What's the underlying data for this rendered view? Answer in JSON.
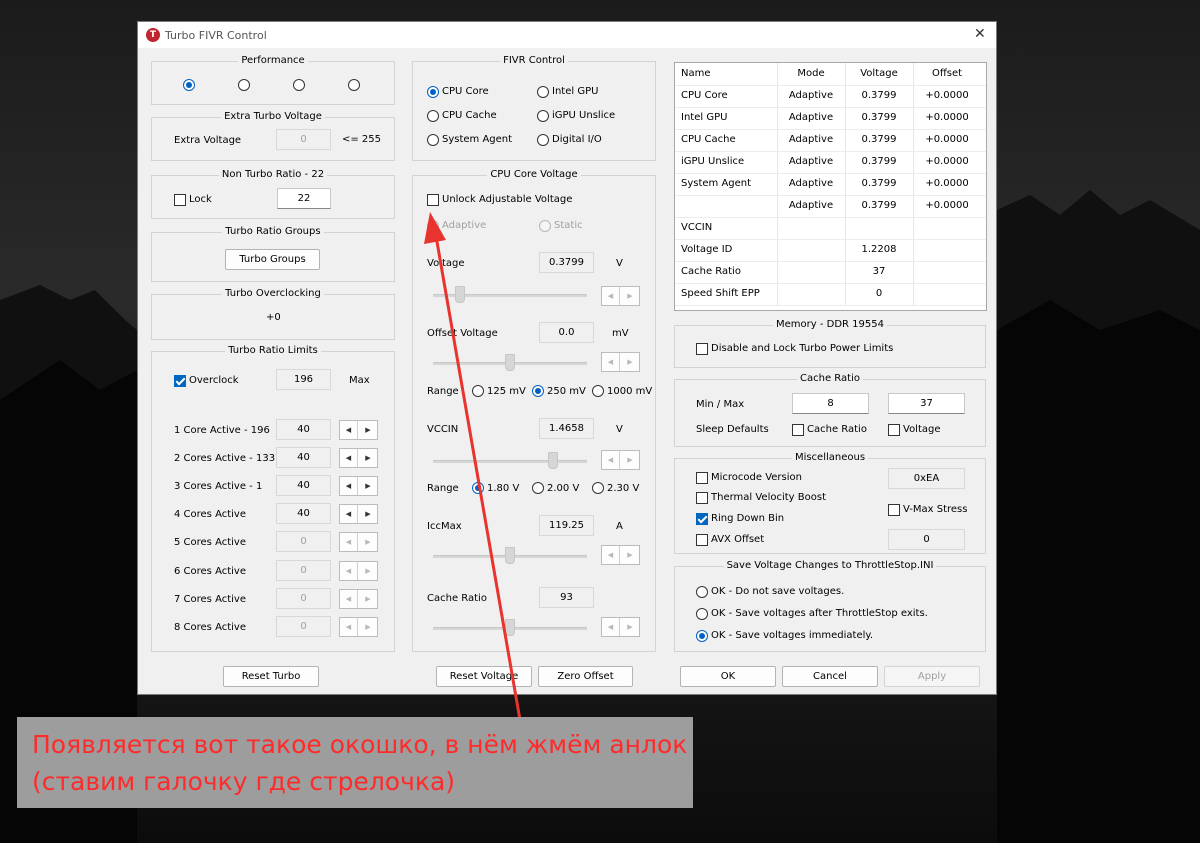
{
  "window": {
    "title": "Turbo FIVR Control",
    "close_glyph": "✕",
    "logo_letter": "T"
  },
  "performance": {
    "title": "Performance",
    "selected_index": 0,
    "option_count": 4
  },
  "extra_turbo": {
    "title": "Extra Turbo Voltage",
    "label": "Extra Voltage",
    "value": "0",
    "hint": "<= 255"
  },
  "non_turbo": {
    "title": "Non Turbo Ratio - 22",
    "lock_label": "Lock",
    "lock_checked": false,
    "value": "22"
  },
  "turbo_groups": {
    "title": "Turbo Ratio Groups",
    "button": "Turbo Groups"
  },
  "turbo_oc": {
    "title": "Turbo Overclocking",
    "value": "+0"
  },
  "turbo_limits": {
    "title": "Turbo Ratio Limits",
    "overclock_label": "Overclock",
    "overclock_checked": true,
    "max_value": "196",
    "max_label": "Max",
    "rows": [
      {
        "label": "1 Core  Active - 196",
        "value": "40",
        "enabled": true
      },
      {
        "label": "2 Cores Active - 133",
        "value": "40",
        "enabled": true
      },
      {
        "label": "3 Cores Active - 1",
        "value": "40",
        "enabled": true
      },
      {
        "label": "4 Cores Active",
        "value": "40",
        "enabled": true
      },
      {
        "label": "5 Cores Active",
        "value": "0",
        "enabled": false
      },
      {
        "label": "6 Cores Active",
        "value": "0",
        "enabled": false
      },
      {
        "label": "7 Cores Active",
        "value": "0",
        "enabled": false
      },
      {
        "label": "8 Cores Active",
        "value": "0",
        "enabled": false
      }
    ]
  },
  "fivr": {
    "title": "FIVR Control",
    "options": [
      "CPU Core",
      "Intel GPU",
      "CPU Cache",
      "iGPU Unslice",
      "System Agent",
      "Digital I/O"
    ],
    "selected": "CPU Core"
  },
  "core_voltage": {
    "title": "CPU Core Voltage",
    "unlock_label": "Unlock Adjustable Voltage",
    "unlock_checked": false,
    "adaptive_label": "Adaptive",
    "static_label": "Static",
    "voltage_label": "Voltage",
    "voltage_value": "0.3799",
    "voltage_unit": "V",
    "voltage_slider": 0.15,
    "offset_label": "Offset Voltage",
    "offset_value": "0.0",
    "offset_unit": "mV",
    "offset_slider": 0.5,
    "range_label": "Range",
    "range_options": [
      "125 mV",
      "250 mV",
      "1000 mV"
    ],
    "range_selected": "250 mV",
    "vccin_label": "VCCIN",
    "vccin_value": "1.4658",
    "vccin_unit": "V",
    "vccin_slider": 0.8,
    "vccin_range_label": "Range",
    "vccin_range_options": [
      "1.80 V",
      "2.00 V",
      "2.30 V"
    ],
    "vccin_range_selected": "1.80 V",
    "iccmax_label": "IccMax",
    "iccmax_value": "119.25",
    "iccmax_unit": "A",
    "iccmax_slider": 0.5,
    "cache_label": "Cache Ratio",
    "cache_value": "93",
    "cache_slider": 0.5
  },
  "table": {
    "headers": [
      "Name",
      "Mode",
      "Voltage",
      "Offset"
    ],
    "rows": [
      [
        "CPU Core",
        "Adaptive",
        "0.3799",
        "+0.0000"
      ],
      [
        "Intel GPU",
        "Adaptive",
        "0.3799",
        "+0.0000"
      ],
      [
        "CPU Cache",
        "Adaptive",
        "0.3799",
        "+0.0000"
      ],
      [
        "iGPU Unslice",
        "Adaptive",
        "0.3799",
        "+0.0000"
      ],
      [
        "System Agent",
        "Adaptive",
        "0.3799",
        "+0.0000"
      ],
      [
        "",
        "Adaptive",
        "0.3799",
        "+0.0000"
      ],
      [
        "VCCIN",
        "",
        "",
        ""
      ],
      [
        "Voltage ID",
        "",
        "1.2208",
        ""
      ],
      [
        "Cache Ratio",
        "",
        "37",
        ""
      ],
      [
        "Speed Shift EPP",
        "",
        "0",
        ""
      ]
    ]
  },
  "memory": {
    "title": "Memory - DDR 19554",
    "label": "Disable and Lock Turbo Power Limits",
    "checked": false
  },
  "cache_ratio": {
    "title": "Cache Ratio",
    "minmax_label": "Min / Max",
    "min": "8",
    "max": "37",
    "sleep_label": "Sleep Defaults",
    "cache_cb": "Cache Ratio",
    "voltage_cb": "Voltage"
  },
  "misc": {
    "title": "Miscellaneous",
    "microcode_label": "Microcode Version",
    "microcode_value": "0xEA",
    "thermal_label": "Thermal Velocity Boost",
    "ringdown_label": "Ring Down Bin",
    "ringdown_checked": true,
    "vmax_label": "V-Max Stress",
    "avx_label": "AVX Offset",
    "avx_value": "0"
  },
  "save": {
    "title": "Save Voltage Changes to ThrottleStop.INI",
    "options": [
      "OK - Do not save voltages.",
      "OK - Save voltages after ThrottleStop exits.",
      "OK - Save voltages immediately."
    ],
    "selected_index": 2
  },
  "buttons": {
    "reset_turbo": "Reset Turbo",
    "reset_voltage": "Reset Voltage",
    "zero_offset": "Zero Offset",
    "ok": "OK",
    "cancel": "Cancel",
    "apply": "Apply"
  },
  "annotation": {
    "line1": "Появляется вот такое окошко, в нём жмём анлок",
    "line2": "(ставим галочку где стрелочка)",
    "color": "#ff2a2a"
  }
}
